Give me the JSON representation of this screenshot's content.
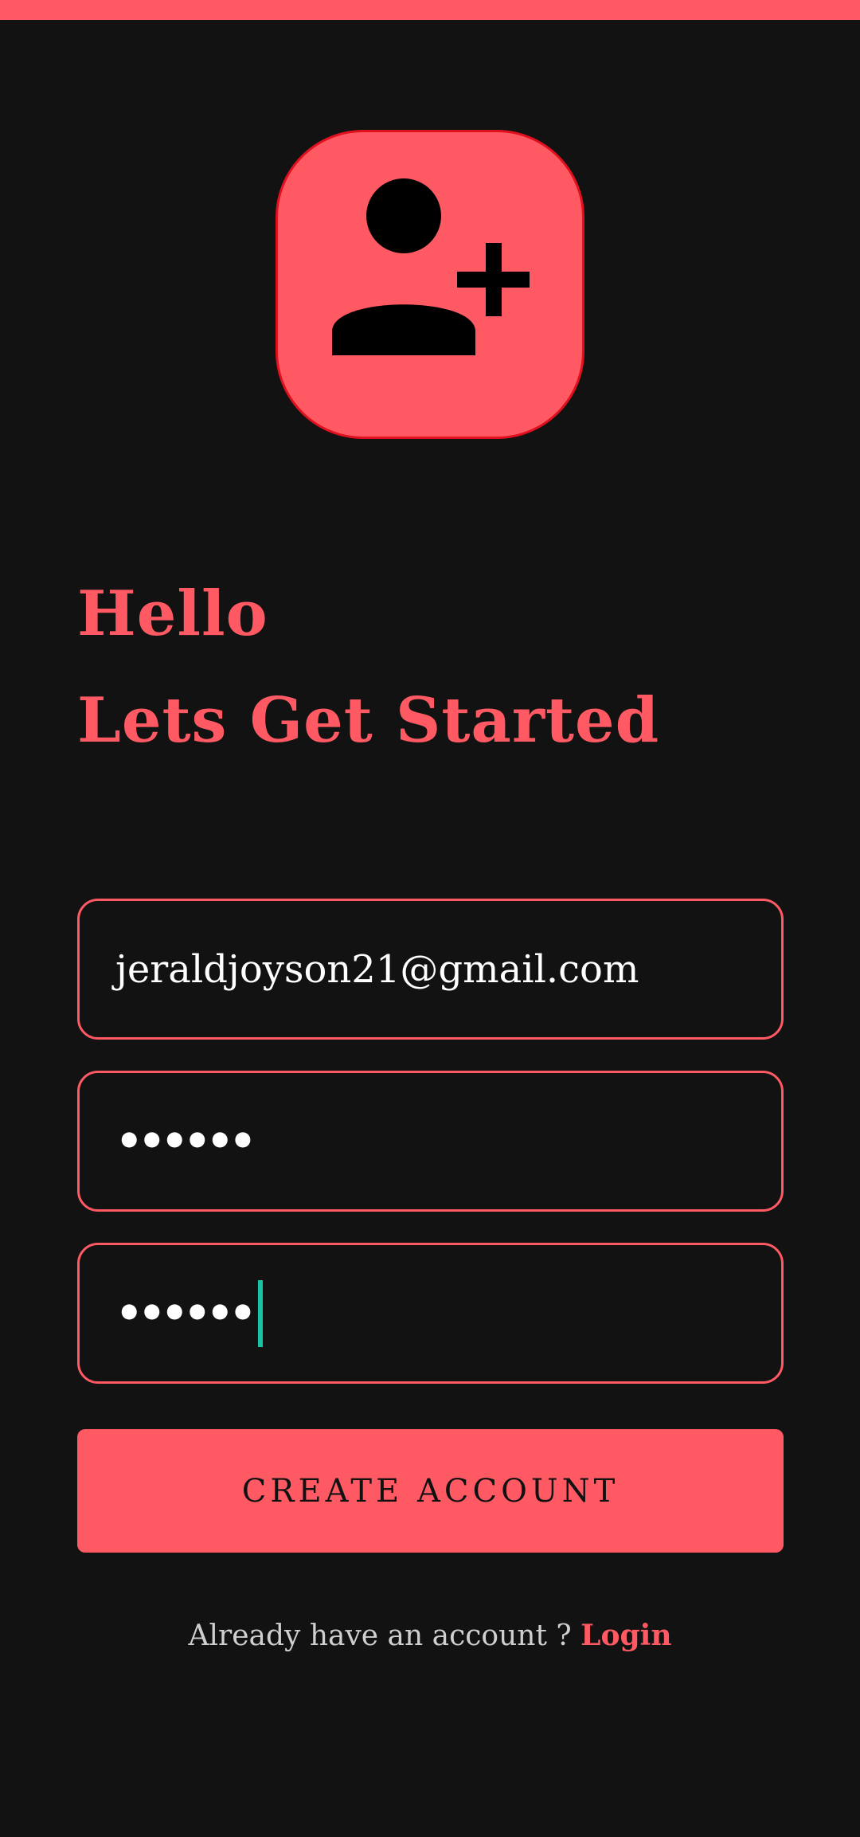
{
  "app": {
    "accent_color": "#FF5A63",
    "background_color": "#121212",
    "logo_icon": "add-user-icon"
  },
  "greeting": {
    "line1": "Hello",
    "line2": "Lets Get Started"
  },
  "form": {
    "email_value": "jeraldjoyson21@gmail.com",
    "password_mask": "••••••",
    "confirm_password_mask": "••••••",
    "submit_label": "CREATE ACCOUNT"
  },
  "footer": {
    "prompt_text": "Already have an account ? ",
    "login_label": "Login"
  }
}
